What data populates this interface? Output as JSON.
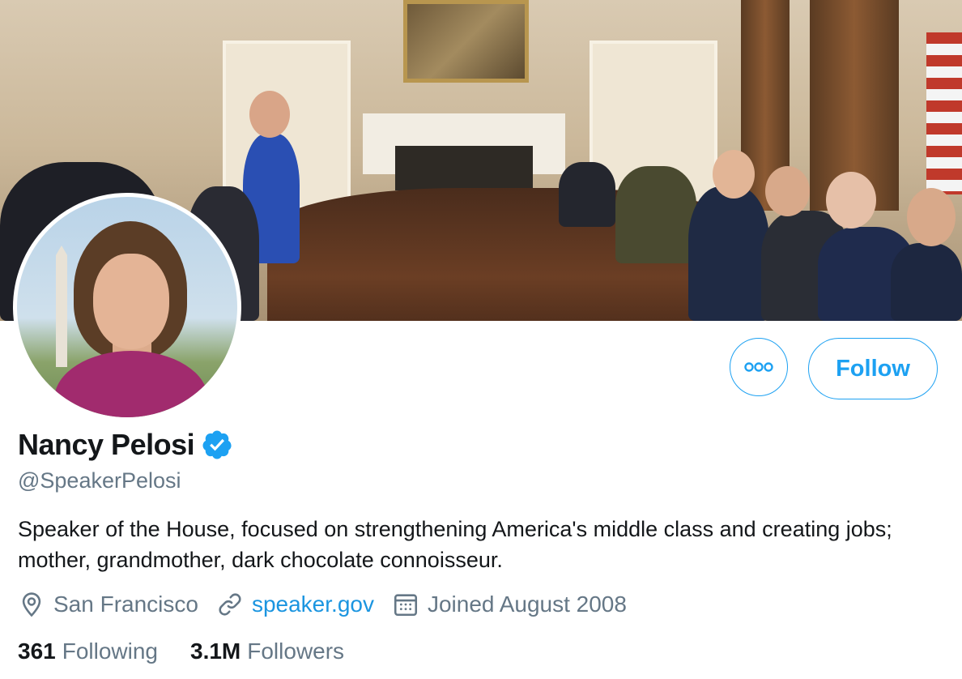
{
  "profile": {
    "display_name": "Nancy Pelosi",
    "verified": true,
    "handle": "@SpeakerPelosi",
    "bio": "Speaker of the House, focused on strengthening America's middle class and creating jobs; mother, grandmother, dark chocolate connoisseur.",
    "location": "San Francisco",
    "website": "speaker.gov",
    "joined": "Joined August 2008"
  },
  "stats": {
    "following_count": "361",
    "following_label": "Following",
    "followers_count": "3.1M",
    "followers_label": "Followers"
  },
  "actions": {
    "follow_label": "Follow"
  },
  "icons": {
    "more": "more-options-icon",
    "verified": "verified-badge-icon",
    "location": "location-pin-icon",
    "link": "link-icon",
    "calendar": "calendar-icon"
  },
  "colors": {
    "accent": "#1da1f2",
    "link": "#1b95e0",
    "text_primary": "#14171a",
    "text_secondary": "#657786"
  }
}
